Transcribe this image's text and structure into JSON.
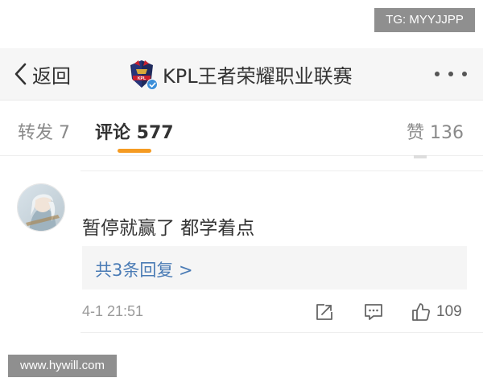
{
  "watermarks": {
    "top": "TG: MYYJJPP",
    "bottom": "www.hywill.com"
  },
  "navbar": {
    "back_label": "返回",
    "title": "KPL王者荣耀职业联赛",
    "logo_icon": "kpl-logo-icon",
    "verified_icon": "verified-badge-icon",
    "more_icon": "more-dots-icon"
  },
  "tabs": {
    "repost": "转发 7",
    "comment": "评论 577",
    "like": "赞 136",
    "active": "comment",
    "accent_color": "#f59b22"
  },
  "comment": {
    "text": "暂停就赢了 都学着点",
    "replies_link": "共3条回复 >",
    "timestamp": "4-1 21:51",
    "like_count": "109",
    "link_color": "#4a7bb5",
    "icons": {
      "share": "share-icon",
      "reply": "comment-icon",
      "like": "thumbs-up-icon",
      "avatar": "avatar"
    }
  }
}
